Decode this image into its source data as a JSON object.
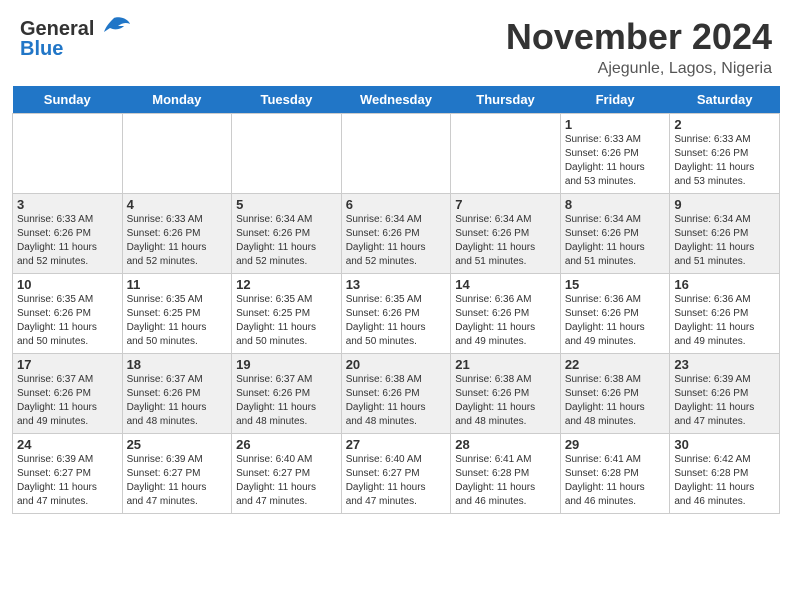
{
  "header": {
    "logo_general": "General",
    "logo_blue": "Blue",
    "month_title": "November 2024",
    "location": "Ajegunle, Lagos, Nigeria"
  },
  "days_of_week": [
    "Sunday",
    "Monday",
    "Tuesday",
    "Wednesday",
    "Thursday",
    "Friday",
    "Saturday"
  ],
  "weeks": [
    {
      "days": [
        {
          "num": "",
          "info": ""
        },
        {
          "num": "",
          "info": ""
        },
        {
          "num": "",
          "info": ""
        },
        {
          "num": "",
          "info": ""
        },
        {
          "num": "",
          "info": ""
        },
        {
          "num": "1",
          "info": "Sunrise: 6:33 AM\nSunset: 6:26 PM\nDaylight: 11 hours\nand 53 minutes."
        },
        {
          "num": "2",
          "info": "Sunrise: 6:33 AM\nSunset: 6:26 PM\nDaylight: 11 hours\nand 53 minutes."
        }
      ]
    },
    {
      "days": [
        {
          "num": "3",
          "info": "Sunrise: 6:33 AM\nSunset: 6:26 PM\nDaylight: 11 hours\nand 52 minutes."
        },
        {
          "num": "4",
          "info": "Sunrise: 6:33 AM\nSunset: 6:26 PM\nDaylight: 11 hours\nand 52 minutes."
        },
        {
          "num": "5",
          "info": "Sunrise: 6:34 AM\nSunset: 6:26 PM\nDaylight: 11 hours\nand 52 minutes."
        },
        {
          "num": "6",
          "info": "Sunrise: 6:34 AM\nSunset: 6:26 PM\nDaylight: 11 hours\nand 52 minutes."
        },
        {
          "num": "7",
          "info": "Sunrise: 6:34 AM\nSunset: 6:26 PM\nDaylight: 11 hours\nand 51 minutes."
        },
        {
          "num": "8",
          "info": "Sunrise: 6:34 AM\nSunset: 6:26 PM\nDaylight: 11 hours\nand 51 minutes."
        },
        {
          "num": "9",
          "info": "Sunrise: 6:34 AM\nSunset: 6:26 PM\nDaylight: 11 hours\nand 51 minutes."
        }
      ]
    },
    {
      "days": [
        {
          "num": "10",
          "info": "Sunrise: 6:35 AM\nSunset: 6:26 PM\nDaylight: 11 hours\nand 50 minutes."
        },
        {
          "num": "11",
          "info": "Sunrise: 6:35 AM\nSunset: 6:25 PM\nDaylight: 11 hours\nand 50 minutes."
        },
        {
          "num": "12",
          "info": "Sunrise: 6:35 AM\nSunset: 6:25 PM\nDaylight: 11 hours\nand 50 minutes."
        },
        {
          "num": "13",
          "info": "Sunrise: 6:35 AM\nSunset: 6:26 PM\nDaylight: 11 hours\nand 50 minutes."
        },
        {
          "num": "14",
          "info": "Sunrise: 6:36 AM\nSunset: 6:26 PM\nDaylight: 11 hours\nand 49 minutes."
        },
        {
          "num": "15",
          "info": "Sunrise: 6:36 AM\nSunset: 6:26 PM\nDaylight: 11 hours\nand 49 minutes."
        },
        {
          "num": "16",
          "info": "Sunrise: 6:36 AM\nSunset: 6:26 PM\nDaylight: 11 hours\nand 49 minutes."
        }
      ]
    },
    {
      "days": [
        {
          "num": "17",
          "info": "Sunrise: 6:37 AM\nSunset: 6:26 PM\nDaylight: 11 hours\nand 49 minutes."
        },
        {
          "num": "18",
          "info": "Sunrise: 6:37 AM\nSunset: 6:26 PM\nDaylight: 11 hours\nand 48 minutes."
        },
        {
          "num": "19",
          "info": "Sunrise: 6:37 AM\nSunset: 6:26 PM\nDaylight: 11 hours\nand 48 minutes."
        },
        {
          "num": "20",
          "info": "Sunrise: 6:38 AM\nSunset: 6:26 PM\nDaylight: 11 hours\nand 48 minutes."
        },
        {
          "num": "21",
          "info": "Sunrise: 6:38 AM\nSunset: 6:26 PM\nDaylight: 11 hours\nand 48 minutes."
        },
        {
          "num": "22",
          "info": "Sunrise: 6:38 AM\nSunset: 6:26 PM\nDaylight: 11 hours\nand 48 minutes."
        },
        {
          "num": "23",
          "info": "Sunrise: 6:39 AM\nSunset: 6:26 PM\nDaylight: 11 hours\nand 47 minutes."
        }
      ]
    },
    {
      "days": [
        {
          "num": "24",
          "info": "Sunrise: 6:39 AM\nSunset: 6:27 PM\nDaylight: 11 hours\nand 47 minutes."
        },
        {
          "num": "25",
          "info": "Sunrise: 6:39 AM\nSunset: 6:27 PM\nDaylight: 11 hours\nand 47 minutes."
        },
        {
          "num": "26",
          "info": "Sunrise: 6:40 AM\nSunset: 6:27 PM\nDaylight: 11 hours\nand 47 minutes."
        },
        {
          "num": "27",
          "info": "Sunrise: 6:40 AM\nSunset: 6:27 PM\nDaylight: 11 hours\nand 47 minutes."
        },
        {
          "num": "28",
          "info": "Sunrise: 6:41 AM\nSunset: 6:28 PM\nDaylight: 11 hours\nand 46 minutes."
        },
        {
          "num": "29",
          "info": "Sunrise: 6:41 AM\nSunset: 6:28 PM\nDaylight: 11 hours\nand 46 minutes."
        },
        {
          "num": "30",
          "info": "Sunrise: 6:42 AM\nSunset: 6:28 PM\nDaylight: 11 hours\nand 46 minutes."
        }
      ]
    }
  ]
}
